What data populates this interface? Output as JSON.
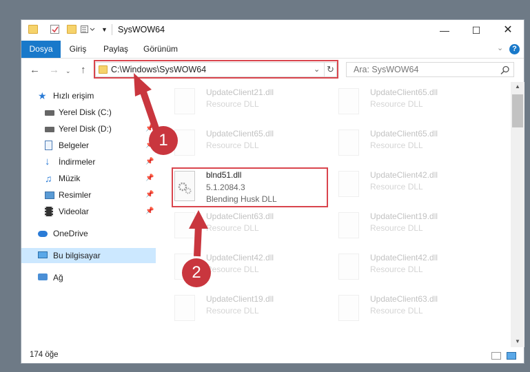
{
  "window": {
    "title": "SysWOW64"
  },
  "ribbon": {
    "tabs": [
      "Dosya",
      "Giriş",
      "Paylaş",
      "Görünüm"
    ]
  },
  "address": {
    "path": "C:\\Windows\\SysWOW64"
  },
  "search": {
    "placeholder": "Ara: SysWOW64"
  },
  "sidebar": {
    "items": [
      {
        "label": "Hızlı erişim",
        "icon": "star-icon"
      },
      {
        "label": "Yerel Disk (C:)",
        "icon": "drive-icon"
      },
      {
        "label": "Yerel Disk (D:)",
        "icon": "drive-icon"
      },
      {
        "label": "Belgeler",
        "icon": "documents-icon"
      },
      {
        "label": "İndirmeler",
        "icon": "download-icon"
      },
      {
        "label": "Müzik",
        "icon": "music-icon"
      },
      {
        "label": "Resimler",
        "icon": "pictures-icon"
      },
      {
        "label": "Videolar",
        "icon": "videos-icon"
      },
      {
        "label": "OneDrive",
        "icon": "cloud-icon"
      },
      {
        "label": "Bu bilgisayar",
        "icon": "computer-icon"
      },
      {
        "label": "Ağ",
        "icon": "network-icon"
      }
    ]
  },
  "files": [
    {
      "name": "UpdateClient21.dll",
      "sub": "Resource DLL"
    },
    {
      "name": "UpdateClient65.dll",
      "sub": "Resource DLL"
    },
    {
      "name": "UpdateClient65.dll",
      "sub": "Resource DLL"
    },
    {
      "name": "UpdateClient65.dll",
      "sub": "Resource DLL"
    },
    {
      "name": "blnd51.dll",
      "version": "5.1.2084.3",
      "sub": "Blending Husk DLL"
    },
    {
      "name": "UpdateClient42.dll",
      "sub": "Resource DLL"
    },
    {
      "name": "UpdateClient63.dll",
      "sub": "Resource DLL"
    },
    {
      "name": "UpdateClient19.dll",
      "sub": "Resource DLL"
    },
    {
      "name": "UpdateClient42.dll",
      "sub": "Resource DLL"
    },
    {
      "name": "UpdateClient42.dll",
      "sub": "Resource DLL"
    },
    {
      "name": "UpdateClient19.dll",
      "sub": "Resource DLL"
    },
    {
      "name": "UpdateClient63.dll",
      "sub": "Resource DLL"
    }
  ],
  "status": {
    "count": "174 öğe"
  },
  "callouts": {
    "one": "1",
    "two": "2"
  },
  "colors": {
    "accent": "#1979ca",
    "highlight": "#d9444c",
    "selected": "#cce8ff"
  }
}
